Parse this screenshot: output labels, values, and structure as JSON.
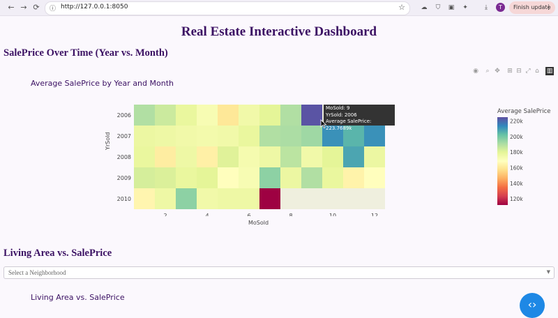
{
  "browser": {
    "back_icon": "←",
    "forward_icon": "→",
    "reload_icon": "⟳",
    "url": "http://127.0.0.1:8050",
    "finish_update": "Finish update",
    "profile_initial": "T"
  },
  "page": {
    "title": "Real Estate Interactive Dashboard",
    "section1_heading": "SalePrice Over Time (Year vs. Month)",
    "plot1_title": "Average SalePrice by Year and Month",
    "section2_heading": "Living Area vs. SalePrice",
    "dropdown_placeholder": "Select a Neighborhood",
    "plot2_title": "Living Area vs. SalePrice"
  },
  "tooltip": {
    "line1": "MoSold: 9",
    "line2": "YrSold: 2006",
    "line3": "Average SalePrice: 223.7689k"
  },
  "chart_data": {
    "type": "heatmap",
    "title": "Average SalePrice by Year and Month",
    "xlabel": "MoSold",
    "ylabel": "YrSold",
    "x": [
      1,
      2,
      3,
      4,
      5,
      6,
      7,
      8,
      9,
      10,
      11,
      12
    ],
    "y": [
      2006,
      2007,
      2008,
      2009,
      2010
    ],
    "x_ticks": [
      2,
      4,
      6,
      8,
      10,
      12
    ],
    "colorbar_title": "Average SalePrice",
    "colorbar_ticks": [
      "220k",
      "200k",
      "180k",
      "160k",
      "140k",
      "120k"
    ],
    "zmin": 112,
    "zmax": 225,
    "colorscale": "Spectral",
    "z": [
      [
        190,
        185,
        178,
        172,
        160,
        175,
        180,
        190,
        224,
        null,
        null,
        null
      ],
      [
        177,
        176,
        175,
        174,
        175,
        178,
        190,
        191,
        193,
        212,
        205,
        212
      ],
      [
        178,
        162,
        176,
        163,
        181,
        173,
        176,
        188,
        175,
        180,
        208,
        177
      ],
      [
        183,
        182,
        178,
        180,
        168,
        172,
        196,
        177,
        190,
        178,
        164,
        168
      ],
      [
        165,
        176,
        196,
        175,
        176,
        176,
        112,
        null,
        null,
        null,
        null,
        null
      ]
    ]
  }
}
